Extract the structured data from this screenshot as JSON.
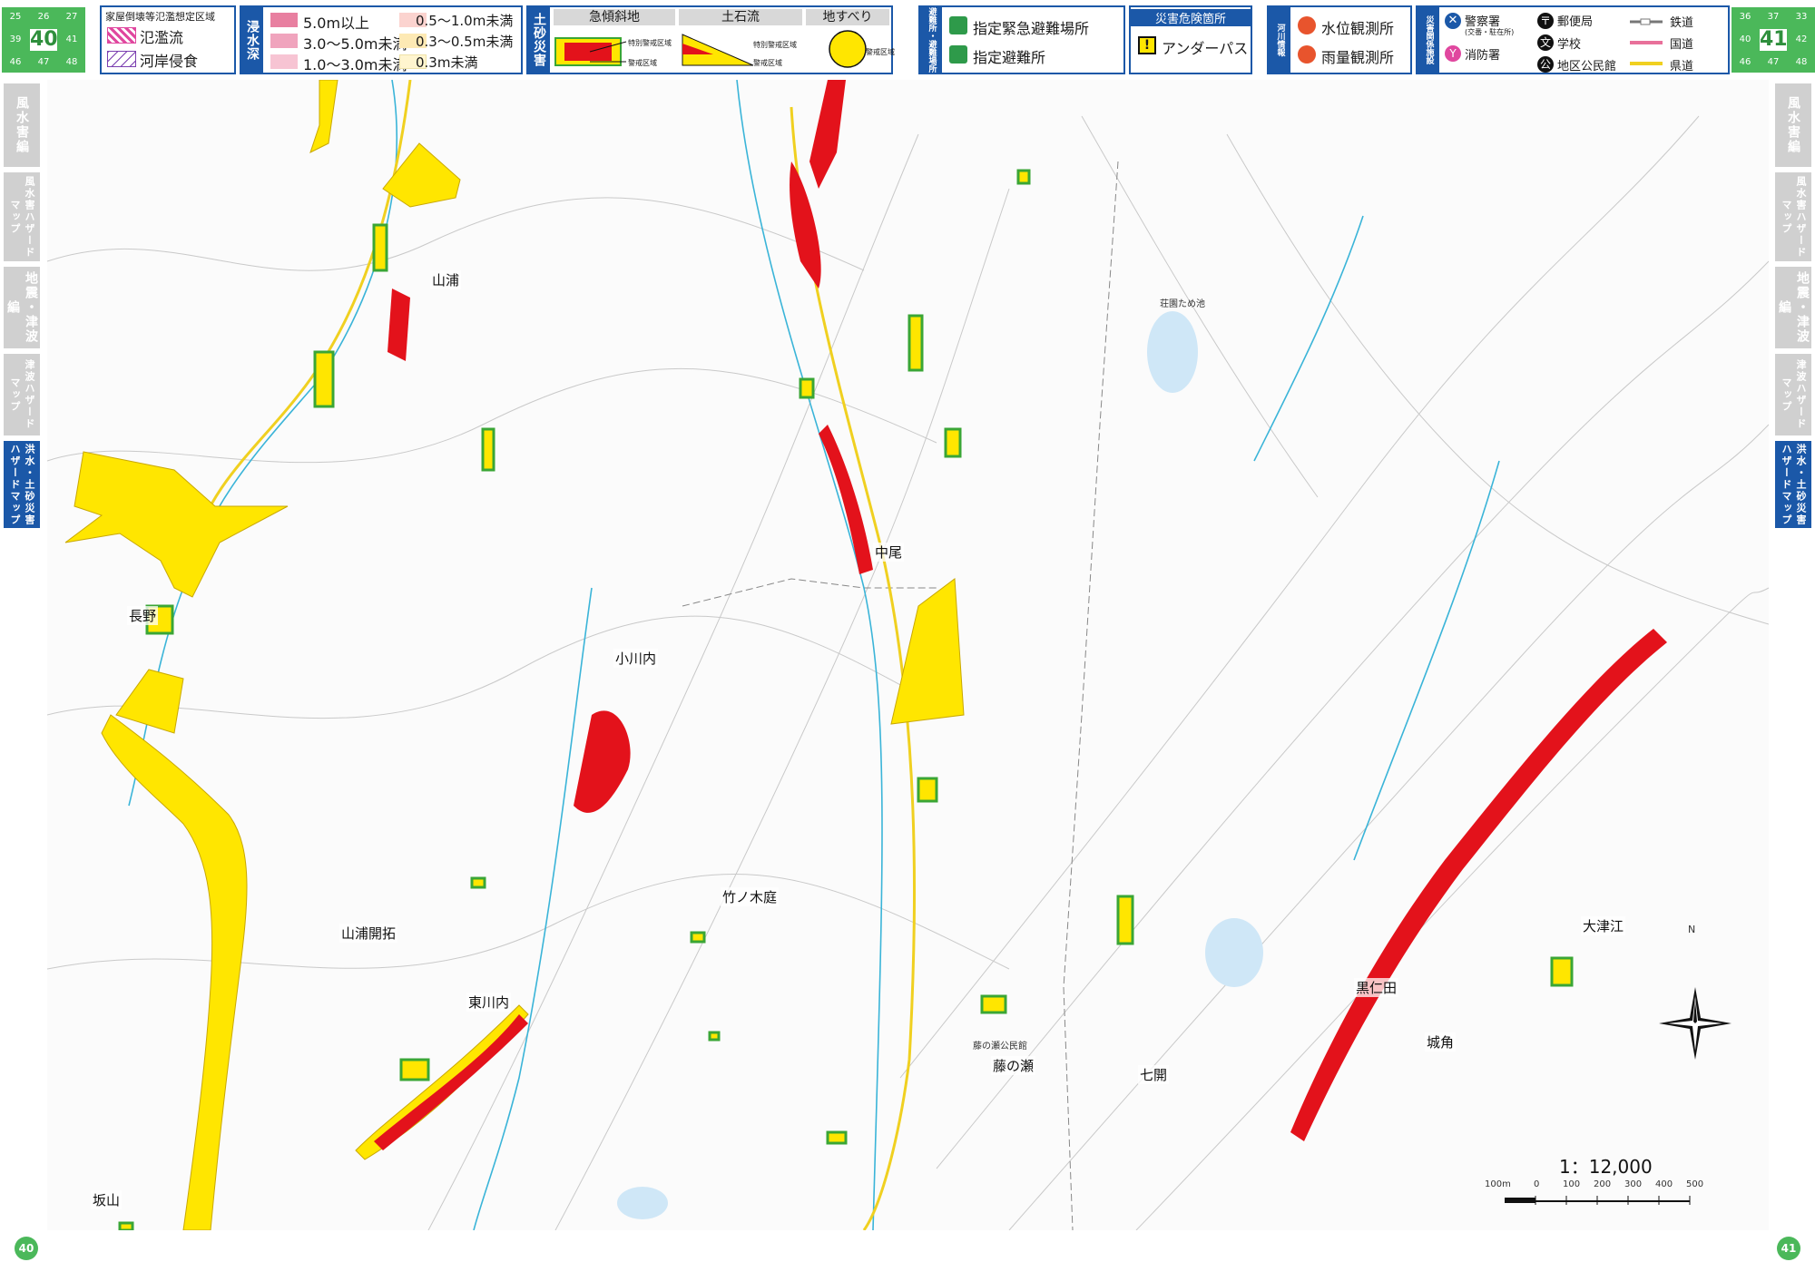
{
  "page_index_left": {
    "cells": [
      "25",
      "26",
      "27",
      "39",
      "41",
      "46",
      "47",
      "48"
    ],
    "current": "40"
  },
  "page_index_right": {
    "cells": [
      "36",
      "37",
      "33",
      "40",
      "42",
      "46",
      "47",
      "48"
    ],
    "current": "41"
  },
  "legend_flood": {
    "title": "家屋倒壊等氾濫想定区域",
    "items": [
      {
        "label": "氾濫流",
        "color": "#e0479f"
      },
      {
        "label": "河岸侵食",
        "color": "#7b3fb0"
      }
    ]
  },
  "legend_depth": {
    "tag": "浸水深",
    "items": [
      {
        "label": "5.0m以上",
        "color": "#e87fa0"
      },
      {
        "label": "3.0～5.0m未満",
        "color": "#f0a4bd"
      },
      {
        "label": "1.0～3.0m未満",
        "color": "#f7c4d3"
      },
      {
        "label": "0.5～1.0m未満",
        "color": "#fbd3cf"
      },
      {
        "label": "0.3～0.5m未満",
        "color": "#fde9b4"
      },
      {
        "label": "0.3m未満",
        "color": "#fff5cf"
      }
    ]
  },
  "legend_sediment": {
    "tag": "土砂災害",
    "headers": [
      "急傾斜地",
      "土石流",
      "地すべり"
    ],
    "notes": {
      "steep_special": "特別警戒区域",
      "steep_warn": "警戒区域",
      "debris_special": "特別警戒区域",
      "debris_warn": "警戒区域",
      "landslide_warn": "警戒区域"
    }
  },
  "legend_shelter": {
    "tag": "避難所・避難場所",
    "items": [
      "指定緊急避難場所",
      "指定避難所"
    ]
  },
  "legend_danger": {
    "title": "災害危険箇所",
    "item": "アンダーパス"
  },
  "legend_river": {
    "tag": "河川情報",
    "items": [
      "水位観測所",
      "雨量観測所"
    ]
  },
  "legend_facility": {
    "tag": "災害関係施設",
    "items": [
      {
        "label": "警察署",
        "sub": "(交番・駐在所)"
      },
      {
        "label": "郵便局"
      },
      {
        "label": "消防署"
      },
      {
        "label": "学校"
      },
      {
        "label": "地区公民館"
      }
    ],
    "lines": [
      {
        "label": "鉄道",
        "color": "#777777"
      },
      {
        "label": "国道",
        "color": "#e8709a"
      },
      {
        "label": "県道",
        "color": "#f0d020"
      }
    ]
  },
  "side_tabs_left": [
    "風水害編",
    "風水害ハザードマップ",
    "地震・津波編",
    "津波ハザードマップ",
    "洪水・土砂災害ハザードマップ"
  ],
  "side_tabs_right": [
    "風水害編",
    "風水害ハザードマップ",
    "地震・津波編",
    "津波ハザードマップ",
    "洪水・土砂災害ハザードマップ"
  ],
  "places": {
    "yamaura": "山浦",
    "nagano": "長野",
    "kogawauchi": "小川内",
    "nakao": "中尾",
    "takenokoba": "竹ノ木庭",
    "yamaura_kaitaku": "山浦開拓",
    "higashikawauchi": "東川内",
    "fujinose": "藤の瀬",
    "nanakai": "七開",
    "kuronida": "黒仁田",
    "shirokado": "城角",
    "otsue": "大津江",
    "sakayama": "坂山",
    "pond": "荘園ため池",
    "hall": "藤の瀬公民館"
  },
  "scale": {
    "ratio": "1：12,000",
    "ticks": [
      "100m",
      "0",
      "100",
      "200",
      "300",
      "400",
      "500"
    ]
  },
  "north": "N",
  "page_numbers": {
    "left": "40",
    "right": "41"
  },
  "colors": {
    "special_zone": "#e3121b",
    "warning_zone": "#ffe600",
    "landslide_outline": "#3aa635",
    "river": "#3ab4d8",
    "accent": "#1b58a8"
  }
}
